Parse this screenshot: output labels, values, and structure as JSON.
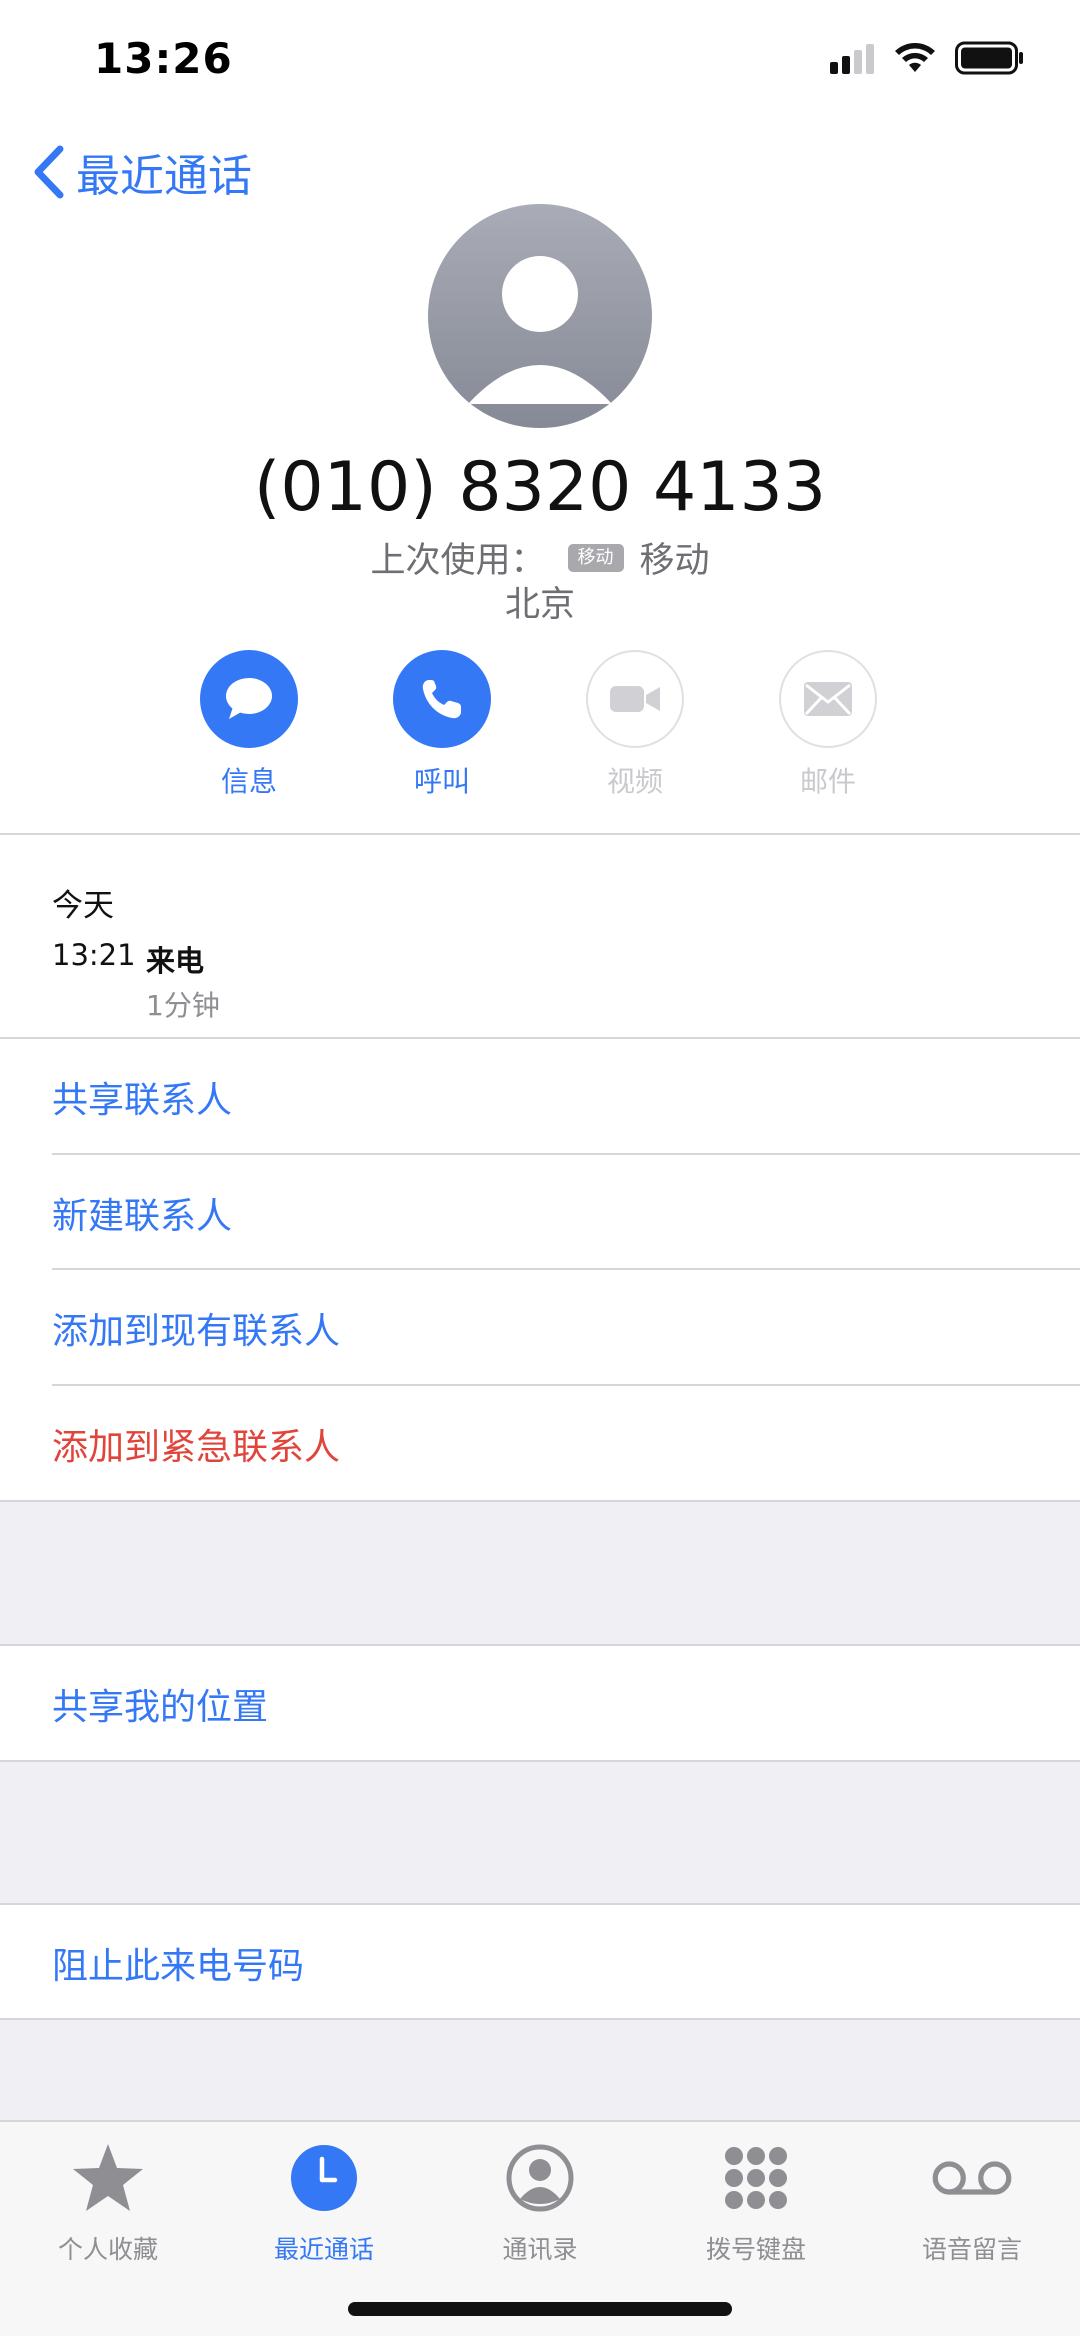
{
  "status_bar": {
    "time": "13:26"
  },
  "nav": {
    "back_label": "最近通话"
  },
  "contact": {
    "number": "(010) 8320 4133",
    "last_used_label": "上次使用：",
    "sim_badge": "移动",
    "carrier": "移动",
    "location": "北京"
  },
  "actions": [
    {
      "label": "信息",
      "icon": "message-icon",
      "enabled": true
    },
    {
      "label": "呼叫",
      "icon": "phone-icon",
      "enabled": true
    },
    {
      "label": "视频",
      "icon": "video-icon",
      "enabled": false
    },
    {
      "label": "邮件",
      "icon": "mail-icon",
      "enabled": false
    }
  ],
  "recent_call": {
    "date_header": "今天",
    "time": "13:21",
    "type": "来电",
    "duration": "1分钟"
  },
  "options": {
    "share_contact": "共享联系人",
    "new_contact": "新建联系人",
    "add_existing": "添加到现有联系人",
    "add_emergency": "添加到紧急联系人",
    "share_location": "共享我的位置",
    "block_caller": "阻止此来电号码"
  },
  "tabs": [
    {
      "label": "个人收藏",
      "icon": "star-icon",
      "active": false
    },
    {
      "label": "最近通话",
      "icon": "clock-icon",
      "active": true
    },
    {
      "label": "通讯录",
      "icon": "person-icon",
      "active": false
    },
    {
      "label": "拨号键盘",
      "icon": "keypad-icon",
      "active": false
    },
    {
      "label": "语音留言",
      "icon": "voicemail-icon",
      "active": false
    }
  ],
  "colors": {
    "accent": "#3478f6",
    "danger": "#e0443a",
    "secondary_text": "#8e8e93"
  }
}
